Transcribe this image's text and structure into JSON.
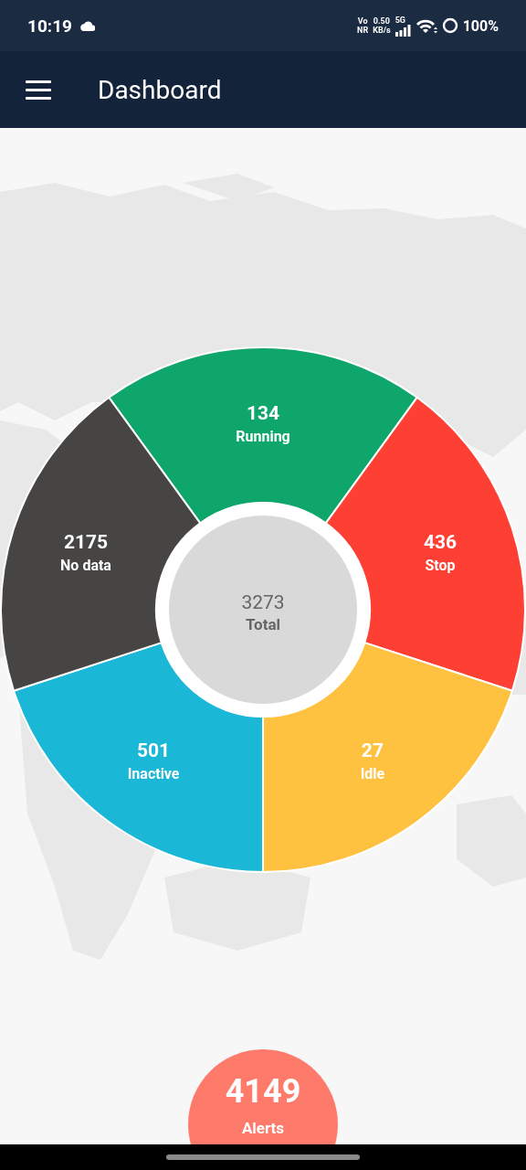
{
  "status_bar": {
    "time": "10:19",
    "volte": [
      "Vo",
      "NR"
    ],
    "speed": [
      "0.50",
      "KB/s"
    ],
    "network": "5G",
    "battery": "100%"
  },
  "app_bar": {
    "title": "Dashboard"
  },
  "status_wheel": {
    "segments": [
      {
        "count": "134",
        "label": "Running",
        "color": "#0fa66b"
      },
      {
        "count": "436",
        "label": "Stop",
        "color": "#fd4033"
      },
      {
        "count": "27",
        "label": "Idle",
        "color": "#fec140"
      },
      {
        "count": "501",
        "label": "Inactive",
        "color": "#1ab7d6"
      },
      {
        "count": "2175",
        "label": "No data",
        "color": "#474444"
      }
    ],
    "total": {
      "count": "3273",
      "label": "Total"
    }
  },
  "alerts": {
    "count": "4149",
    "label": "Alerts"
  }
}
